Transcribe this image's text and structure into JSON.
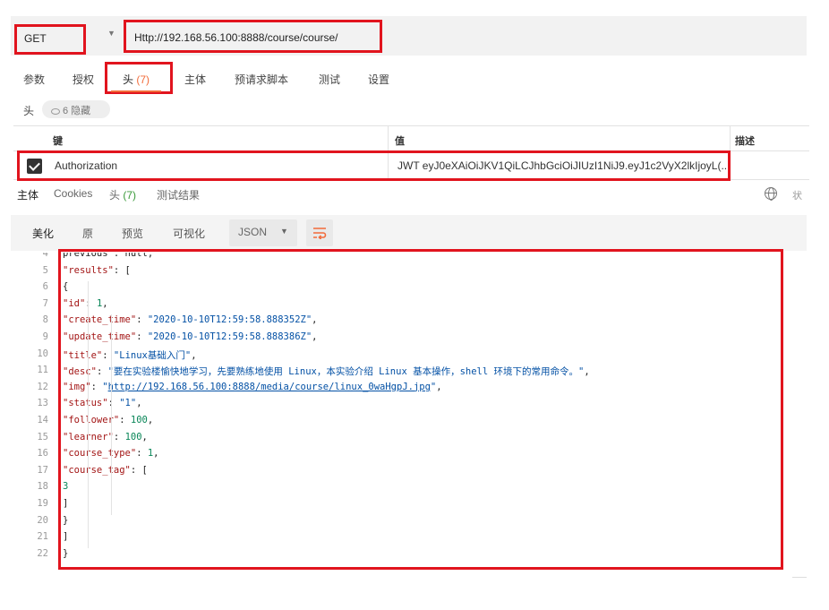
{
  "request": {
    "method": "GET",
    "url": "Http://192.168.56.100:8888/course/course/"
  },
  "request_tabs": [
    {
      "label": "参数",
      "count": ""
    },
    {
      "label": "授权",
      "count": ""
    },
    {
      "label": "头",
      "count": "(7)"
    },
    {
      "label": "主体",
      "count": ""
    },
    {
      "label": "预请求脚本",
      "count": ""
    },
    {
      "label": "测试",
      "count": ""
    },
    {
      "label": "设置",
      "count": ""
    }
  ],
  "headers_section": {
    "label": "头",
    "hidden_label": "6 隐藏",
    "columns": {
      "key": "键",
      "value": "值",
      "description": "描述"
    },
    "rows": [
      {
        "key": "Authorization",
        "value": "JWT eyJ0eXAiOiJKV1QiLCJhbGciOiJIUzI1NiJ9.eyJ1c2VyX2lkIjoyL(..."
      }
    ]
  },
  "response_tabs": [
    {
      "label": "主体",
      "count": ""
    },
    {
      "label": "Cookies",
      "count": ""
    },
    {
      "label": "头",
      "count": "(7)"
    },
    {
      "label": "测试结果",
      "count": ""
    }
  ],
  "response_status_label": "状",
  "view_modes": [
    "美化",
    "原",
    "预览",
    "可视化"
  ],
  "format": "JSON",
  "code_lines": [
    {
      "n": "4",
      "text": "    previous : null,"
    },
    {
      "n": "5",
      "text": "    \"results\": ["
    },
    {
      "n": "6",
      "text": "        {"
    },
    {
      "n": "7",
      "text": "            \"id\": 1,"
    },
    {
      "n": "8",
      "text": "            \"create_time\": \"2020-10-10T12:59:58.888352Z\","
    },
    {
      "n": "9",
      "text": "            \"update_time\": \"2020-10-10T12:59:58.888386Z\","
    },
    {
      "n": "10",
      "text": "            \"title\": \"Linux基础入门\","
    },
    {
      "n": "11",
      "text": "            \"desc\": \"要在实验楼愉快地学习，先要熟练地使用 Linux，本实验介绍 Linux 基本操作，shell 环境下的常用命令。\","
    },
    {
      "n": "12",
      "text": "            \"img\": \"http://192.168.56.100:8888/media/course/linux_0waHgpJ.jpg\","
    },
    {
      "n": "13",
      "text": "            \"status\": \"1\","
    },
    {
      "n": "14",
      "text": "            \"follower\": 100,"
    },
    {
      "n": "15",
      "text": "            \"learner\": 100,"
    },
    {
      "n": "16",
      "text": "            \"course_type\": 1,"
    },
    {
      "n": "17",
      "text": "            \"course_tag\": ["
    },
    {
      "n": "18",
      "text": "                3"
    },
    {
      "n": "19",
      "text": "            ]"
    },
    {
      "n": "20",
      "text": "        }"
    },
    {
      "n": "21",
      "text": "    ]"
    },
    {
      "n": "22",
      "text": "}"
    }
  ],
  "colors": {
    "highlight": "#e1141e",
    "accent": "#f26b3a",
    "key": "#a31515",
    "string": "#0451a5",
    "number": "#098658"
  }
}
